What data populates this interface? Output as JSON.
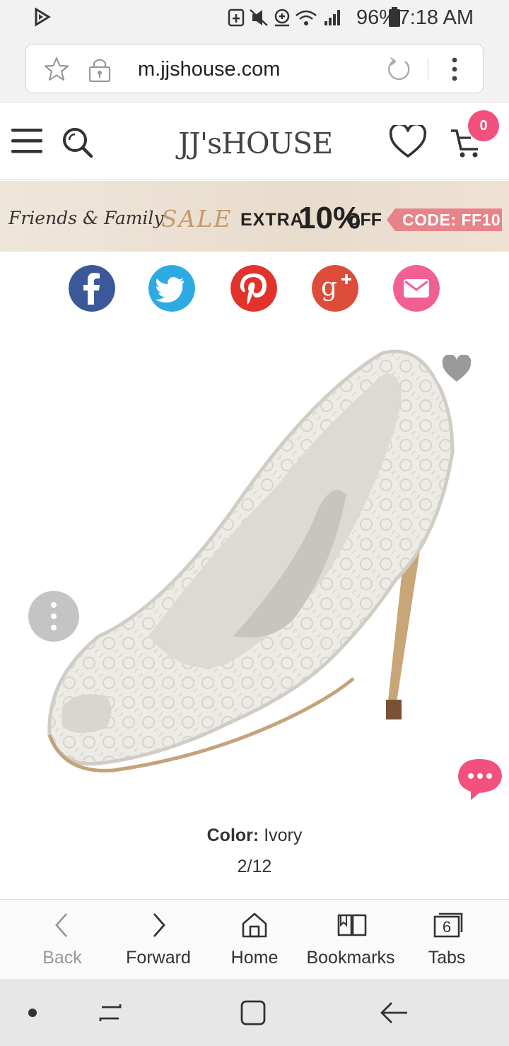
{
  "status_bar": {
    "battery": "96%",
    "time": "7:18 AM"
  },
  "browser": {
    "url": "m.jjshouse.com"
  },
  "site": {
    "logo": "JJ'sHOUSE",
    "cart_count": "0"
  },
  "promo": {
    "friends_family": "Friends & Family",
    "sale": "SALE",
    "extra": "EXTRA",
    "percent": "10%",
    "off": "OFF",
    "code": "CODE: FF10"
  },
  "share": {
    "icons": [
      "facebook-icon",
      "twitter-icon",
      "pinterest-icon",
      "google-plus-icon",
      "email-icon"
    ],
    "colors": [
      "#3b5998",
      "#2eaae3",
      "#e1332b",
      "#dd4b39",
      "#f25f94"
    ]
  },
  "product": {
    "color_label": "Color:",
    "color_value": "Ivory",
    "image_counter": "2/12"
  },
  "toolbar": {
    "items": [
      {
        "label": "Back",
        "icon": "back-icon"
      },
      {
        "label": "Forward",
        "icon": "forward-icon"
      },
      {
        "label": "Home",
        "icon": "home-icon"
      },
      {
        "label": "Bookmarks",
        "icon": "bookmarks-icon"
      },
      {
        "label": "Tabs",
        "icon": "tabs-icon",
        "count": "6"
      }
    ]
  },
  "colors": {
    "accent_pink": "#f2517d",
    "banner_code_bg": "#e8838a",
    "sale_gold": "#c49a6c"
  }
}
